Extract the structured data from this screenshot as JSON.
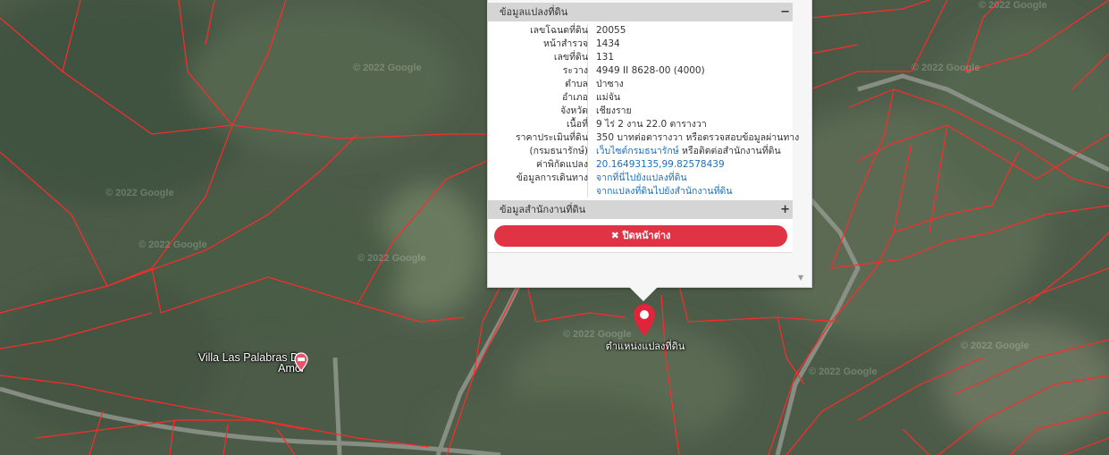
{
  "map": {
    "watermark": "© 2022 Google",
    "place_label": "Villa Las Palabras De Amor",
    "marker_label": "ตำแหน่งแปลงที่ดิน",
    "colors": {
      "parcel_line": "#ff2a2a",
      "road": "#9a9e96",
      "marker": "#e0243a"
    }
  },
  "popup": {
    "section1_title": "ข้อมูลแปลงที่ดิน",
    "section1_toggle": "−",
    "rows": [
      {
        "label": "เลขโฉนดที่ดิน",
        "value": "20055"
      },
      {
        "label": "หน้าสำรวจ",
        "value": "1434"
      },
      {
        "label": "เลขที่ดิน",
        "value": "131"
      },
      {
        "label": "ระวาง",
        "value": "4949 II 8628-00 (4000)"
      },
      {
        "label": "ตำบล",
        "value": "ป่าซาง"
      },
      {
        "label": "อำเภอ",
        "value": "แม่จัน"
      },
      {
        "label": "จังหวัด",
        "value": "เชียงราย"
      },
      {
        "label": "เนื้อที่",
        "value": "9 ไร่ 2 งาน 22.0 ตารางวา"
      },
      {
        "label": "ราคาประเมินที่ดิน",
        "value": "350 บาทต่อตารางวา หรือตรวจสอบข้อมูลผ่านทาง"
      },
      {
        "label": "(กรมธนารักษ์)",
        "value_link": "เว็บไซต์กรมธนารักษ์",
        "value_rest": " หรือติดต่อสำนักงานที่ดิน"
      },
      {
        "label": "ค่าพิกัดแปลง",
        "value": "20.16493135,99.82578439"
      },
      {
        "label": "ข้อมูลการเดินทาง",
        "value": "จากที่นี่ไปยังแปลงที่ดิน"
      },
      {
        "label": "",
        "value": "จากแปลงที่ดินไปยังสำนักงานที่ดิน"
      }
    ],
    "section2_title": "ข้อมูลสำนักงานที่ดิน",
    "section2_toggle": "+",
    "close_label": "✖ ปิดหน้าต่าง"
  }
}
